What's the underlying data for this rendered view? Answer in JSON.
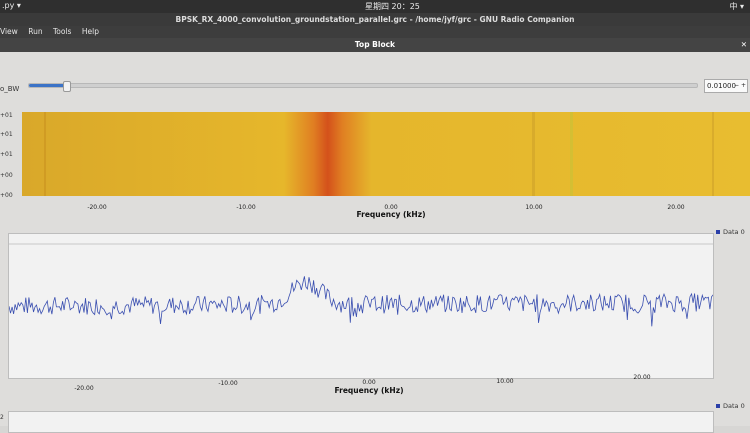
{
  "system_bar": {
    "app": ".py ▾",
    "clock": "星期四 20：25",
    "right": "中 ▾"
  },
  "window_title": "BPSK_RX_4000_convolution_groundstation_parallel.grc - /home/jyf/grc - GNU Radio Companion",
  "menu": [
    "View",
    "Run",
    "Tools",
    "Help"
  ],
  "block_title": "Top Block",
  "block_close": "✕",
  "slider": {
    "label": "o_BW",
    "value": "0.01000",
    "level": 0.055
  },
  "waterfall": {
    "y_ticks": [
      "+01",
      "+01",
      "+01",
      "+00",
      "+00"
    ],
    "x_ticks": [
      "-20.00",
      "-10.00",
      "0.00",
      "10.00",
      "20.00"
    ],
    "xlabel": "Frequency (kHz)"
  },
  "chart_data": {
    "type": "line",
    "xlabel": "Frequency (kHz)",
    "x_ticks": [
      "-20.00",
      "-10.00",
      "0.00",
      "10.00",
      "20.00"
    ],
    "xlim": [
      -25.5,
      25.5
    ],
    "ylim": [
      -10,
      10
    ],
    "series": [
      {
        "name": "Data 0",
        "color": "#3a4fb0",
        "peak_freq": -4.0,
        "peak_height": 3.2,
        "noise_floor": 0
      }
    ]
  },
  "second_plot": {
    "legend": "Data 0",
    "ylabel_fragment": "2"
  },
  "colors": {
    "signal": "#3a4fb0",
    "waterfall_bg": "#e0b12a",
    "waterfall_peak": "#d9541a"
  }
}
